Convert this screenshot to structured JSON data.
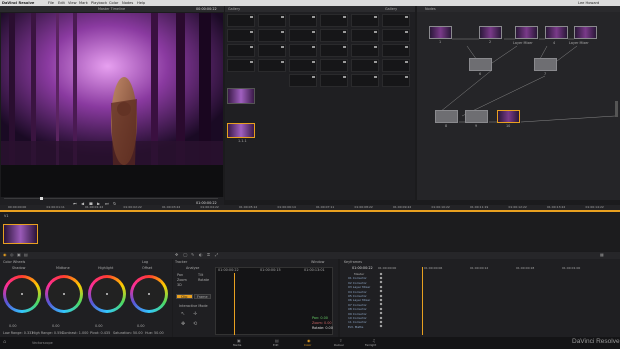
{
  "menubar": {
    "app": "DaVinci Resolve",
    "items": [
      "File",
      "Edit",
      "View",
      "Mark",
      "Playback",
      "Color",
      "Nodes",
      "Help"
    ],
    "user": "Lee Howard"
  },
  "viewer": {
    "title": "Master Timeline",
    "timecode": "00:00:00:22"
  },
  "gallery": {
    "title": "Gallery",
    "still_label": "1.1.1",
    "mid_label": "Gallery"
  },
  "nodes": {
    "title": "Nodes",
    "node_labels": [
      "Layer Mixer",
      "Layer Mixer"
    ],
    "numbers": [
      "1",
      "2",
      "3",
      "4",
      "5",
      "6",
      "7",
      "8",
      "9",
      "10"
    ]
  },
  "transport": {
    "timecode": "01:00:00:22"
  },
  "ruler": {
    "ticks": [
      "00:00:00:00",
      "01:00:01:11",
      "01:00:01:22",
      "01:00:02:22",
      "01:00:03:22",
      "01:00:04:22",
      "01:00:05:12",
      "01:00:06:14",
      "01:00:07:11",
      "01:00:08:22",
      "01:00:09:22",
      "01:00:10:22",
      "01:00:11:19",
      "01:00:12:22",
      "01:00:13:22",
      "01:00:14:22"
    ]
  },
  "clip": {
    "label": "V1"
  },
  "color_wheels": {
    "title": "Color Wheels",
    "mode": "Log",
    "wheels": [
      "Shadow",
      "Midtone",
      "Highlight",
      "Offset"
    ],
    "values": [
      "0.00",
      "0.00",
      "0.00",
      "0.00"
    ],
    "bottom": [
      "Low Range: 0.333",
      "High Range: 0.550",
      "Contrast: 1.000",
      "Pivot: 0.435",
      "Saturation: 50.00",
      "Hue: 50.00"
    ]
  },
  "tracker": {
    "title": "Tracker",
    "analyse": "Analyse",
    "checks": [
      "Pan",
      "Tilt",
      "Zoom",
      "Rotate",
      "3D"
    ],
    "clip": "Clip",
    "frame": "Frame",
    "interactive": "Interactive Mode",
    "window": "Window",
    "tc_ticks": [
      "01:00:00:22",
      "01:00:00:15",
      "01:00:13:01"
    ],
    "legend": [
      "Pan: 0.00",
      "Zoom: 0.00",
      "Rotate: 0.00"
    ]
  },
  "keyframes": {
    "title": "Keyframes",
    "tc": "01:00:00:22",
    "tc_ticks": [
      "01:00:00:00",
      "01:00:00:06",
      "01:00:00:12",
      "01:00:00:18",
      "01:00:01:00"
    ],
    "rows": [
      "Master",
      "01 Corrector",
      "02 Corrector",
      "03 Layer Mixer",
      "04 Corrector",
      "05 Corrector",
      "06 Layer Mixer",
      "07 Corrector",
      "08 Corrector",
      "09 Corrector",
      "10 Corrector",
      "11 Corrector",
      "Ext. Matte"
    ]
  },
  "pages": [
    "Media",
    "Edit",
    "Color",
    "Deliver",
    "Fairlight"
  ],
  "brand": "DaVinci Resolve",
  "status": "Vectorscope",
  "accent": "#e8a020"
}
